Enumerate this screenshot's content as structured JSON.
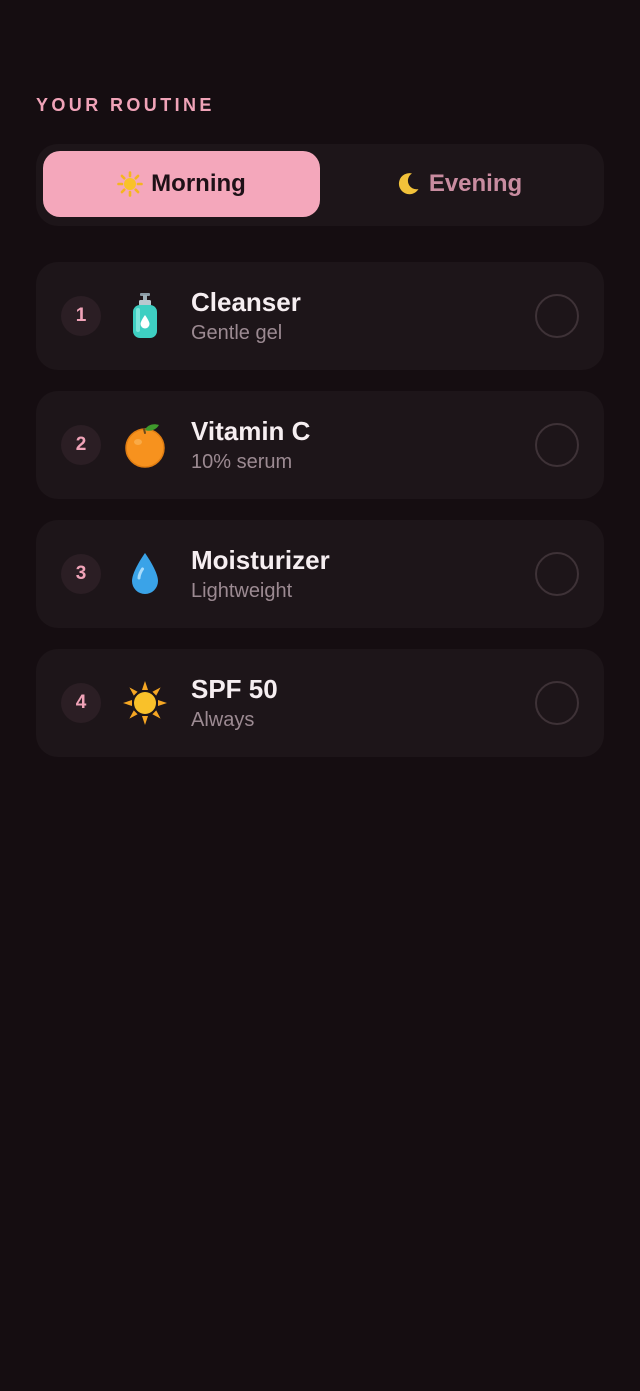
{
  "header": {
    "title": "YOUR ROUTINE"
  },
  "tabs": [
    {
      "icon": "sun-icon",
      "label": "Morning",
      "active": true
    },
    {
      "icon": "crescent-moon-icon",
      "label": "Evening",
      "active": false
    }
  ],
  "steps": [
    {
      "number": "1",
      "icon": "lotion-bottle-icon",
      "name": "Cleanser",
      "description": "Gentle gel",
      "checked": false
    },
    {
      "number": "2",
      "icon": "tangerine-icon",
      "name": "Vitamin C",
      "description": "10% serum",
      "checked": false
    },
    {
      "number": "3",
      "icon": "droplet-icon",
      "name": "Moisturizer",
      "description": "Lightweight",
      "checked": false
    },
    {
      "number": "4",
      "icon": "sun-icon",
      "name": "SPF 50",
      "description": "Always",
      "checked": false
    }
  ],
  "colors": {
    "background": "#150d11",
    "card": "#1d1519",
    "accent_pink": "#f4a7bb",
    "label_pink": "#f0a3b8",
    "muted_text": "#9c8a92"
  }
}
